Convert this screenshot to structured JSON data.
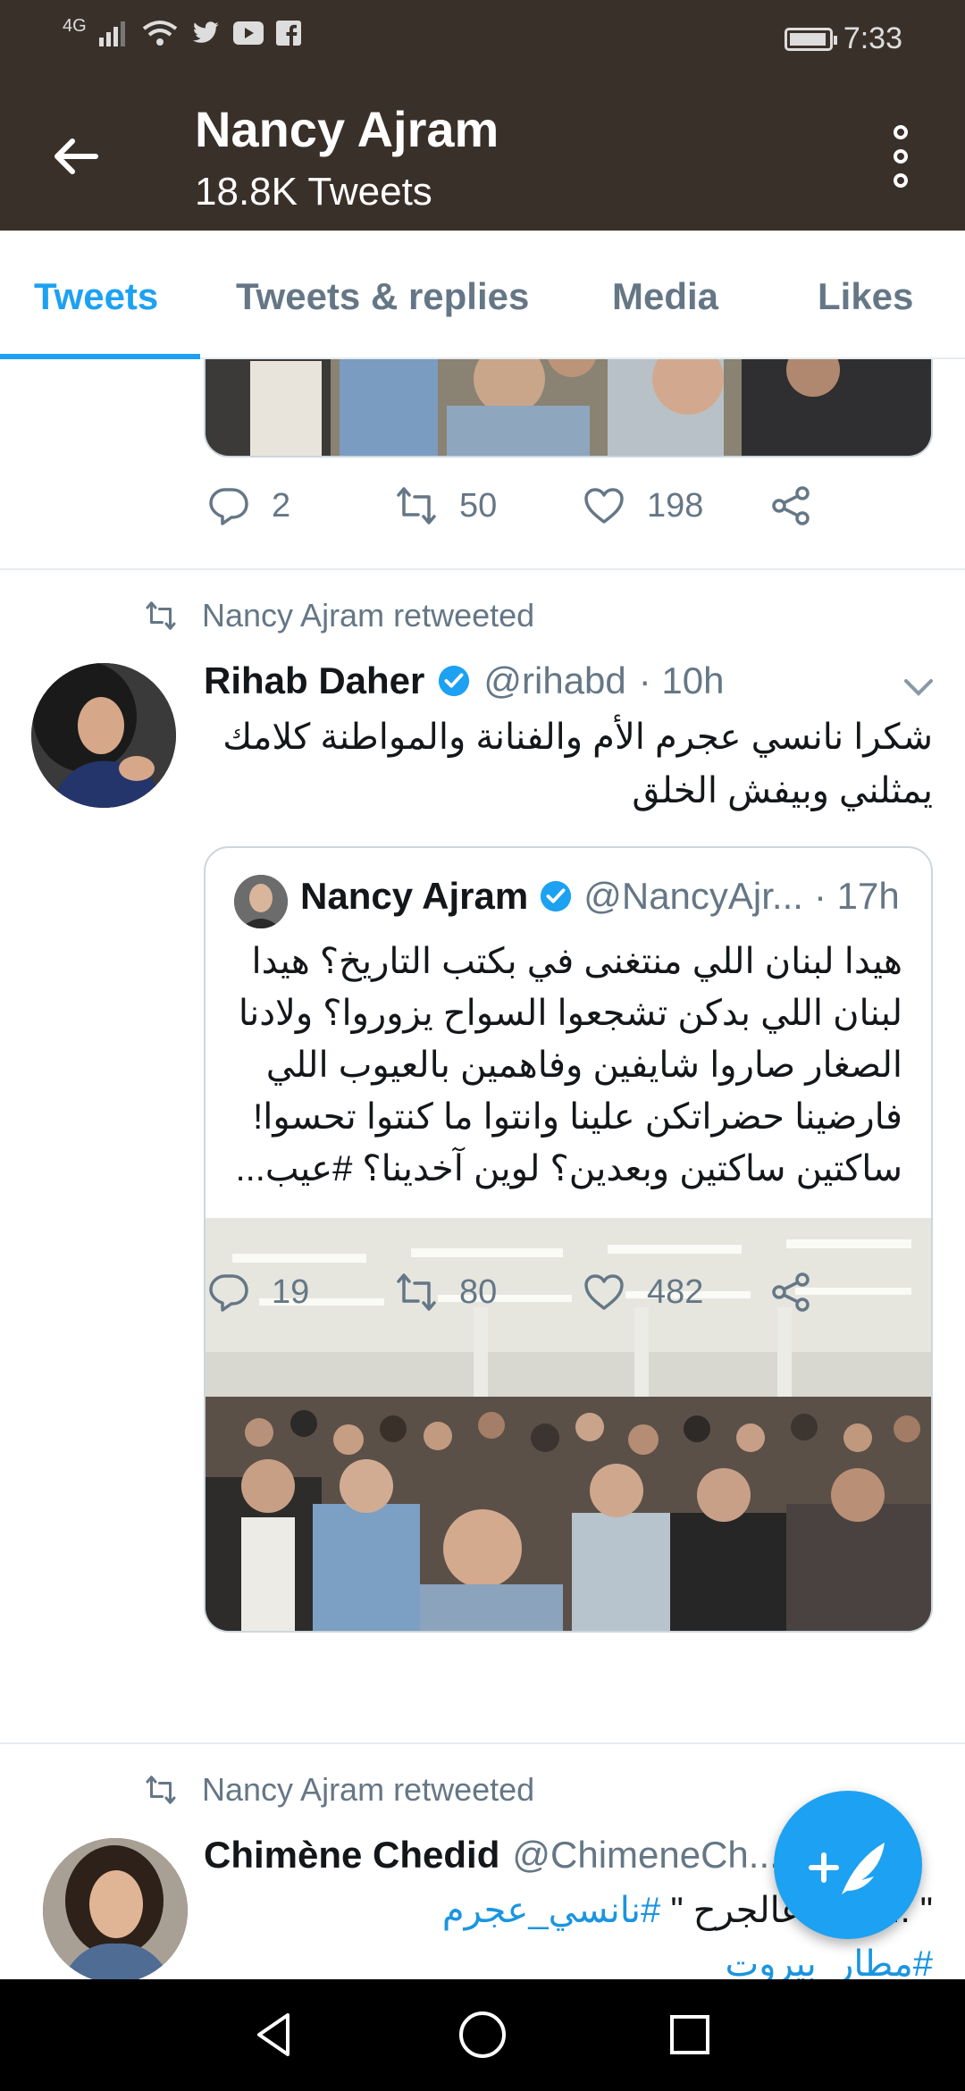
{
  "status_bar": {
    "network": "4G",
    "time": "7:33",
    "battery_level": 0.9
  },
  "header": {
    "name": "Nancy Ajram",
    "tweet_count": "18.8K Tweets"
  },
  "tabs": [
    {
      "label": "Tweets",
      "active": true
    },
    {
      "label": "Tweets & replies",
      "active": false
    },
    {
      "label": "Media",
      "active": false
    },
    {
      "label": "Likes",
      "active": false
    }
  ],
  "tweet1": {
    "replies": "2",
    "retweets": "50",
    "likes": "198"
  },
  "tweet2": {
    "retweet_label": "Nancy Ajram retweeted",
    "name": "Rihab Daher",
    "handle": "@rihabd",
    "time": "· 10h",
    "text_line1": "شكرا نانسي عجرم الأم والفنانة والمواطنة كلامك",
    "text_line2": "يمثلني وبيفش الخلق",
    "quote": {
      "name": "Nancy Ajram",
      "handle": "@NancyAjr...",
      "time": "· 17h",
      "lines": [
        "هيدا لبنان اللي منتغنى في بكتب التاريخ؟ هيدا",
        "لبنان اللي بدكن تشجعوا السواح يزوروا؟ ولادنا",
        "الصغار صاروا شايفين وفاهمين بالعيوب اللي",
        "فارضينا حضراتكن علينا وانتوا ما كنتوا تحسوا!",
        "ساكتين ساكتين وبعدين؟ لوين آخدينا؟ #عيب..."
      ]
    },
    "replies": "19",
    "retweets": "80",
    "likes": "482"
  },
  "tweet3": {
    "retweet_label": "Nancy Ajram retweeted",
    "name": "Chimène Chedid",
    "handle": "@ChimeneCh...",
    "text_plain": "\" ... بدها عالجرح \"",
    "hashtag1": "#نانسي_عجرم",
    "hashtag2": "#مطار_بيروت"
  },
  "colors": {
    "header_bg": "#3a302a",
    "accent": "#1da1f2",
    "secondary_text": "#657786"
  }
}
